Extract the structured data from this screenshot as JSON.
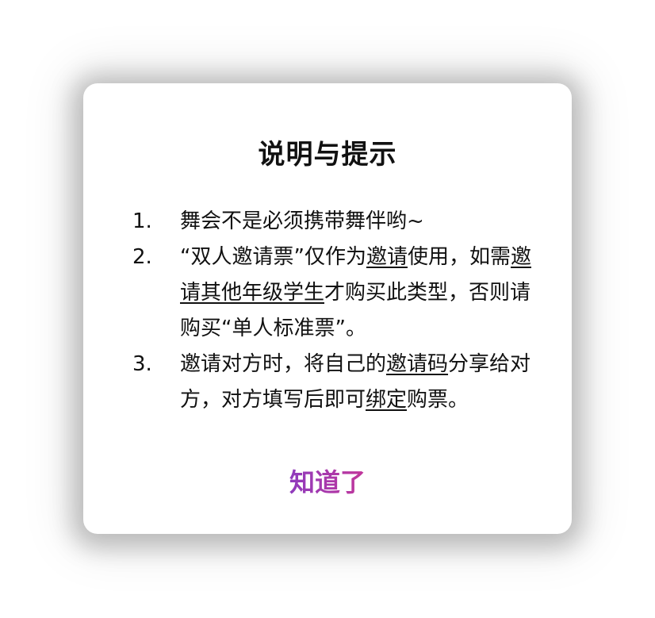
{
  "dialog": {
    "title": "说明与提示",
    "notes": [
      {
        "number": "1.",
        "segments": [
          {
            "text": "舞会不是必须携带舞伴哟~"
          }
        ]
      },
      {
        "number": "2.",
        "segments": [
          {
            "text": "“双人邀请票”仅作为"
          },
          {
            "text": "邀请",
            "underline": true
          },
          {
            "text": "使用，如需"
          },
          {
            "text": "邀请其他年级学生",
            "underline": true
          },
          {
            "text": "才购买此类型，否则请购买“单人标准票”。"
          }
        ]
      },
      {
        "number": "3.",
        "segments": [
          {
            "text": "邀请对方时，将自己的"
          },
          {
            "text": "邀请码",
            "underline": true
          },
          {
            "text": "分享给对方，对方填写后即可"
          },
          {
            "text": "绑定",
            "underline": true
          },
          {
            "text": "购票。"
          }
        ]
      }
    ],
    "confirm_label": "知道了"
  },
  "colors": {
    "accent_start": "#8f3bbd",
    "accent_end": "#c2369a",
    "text": "#111111",
    "dialog_background": "#ffffff"
  }
}
